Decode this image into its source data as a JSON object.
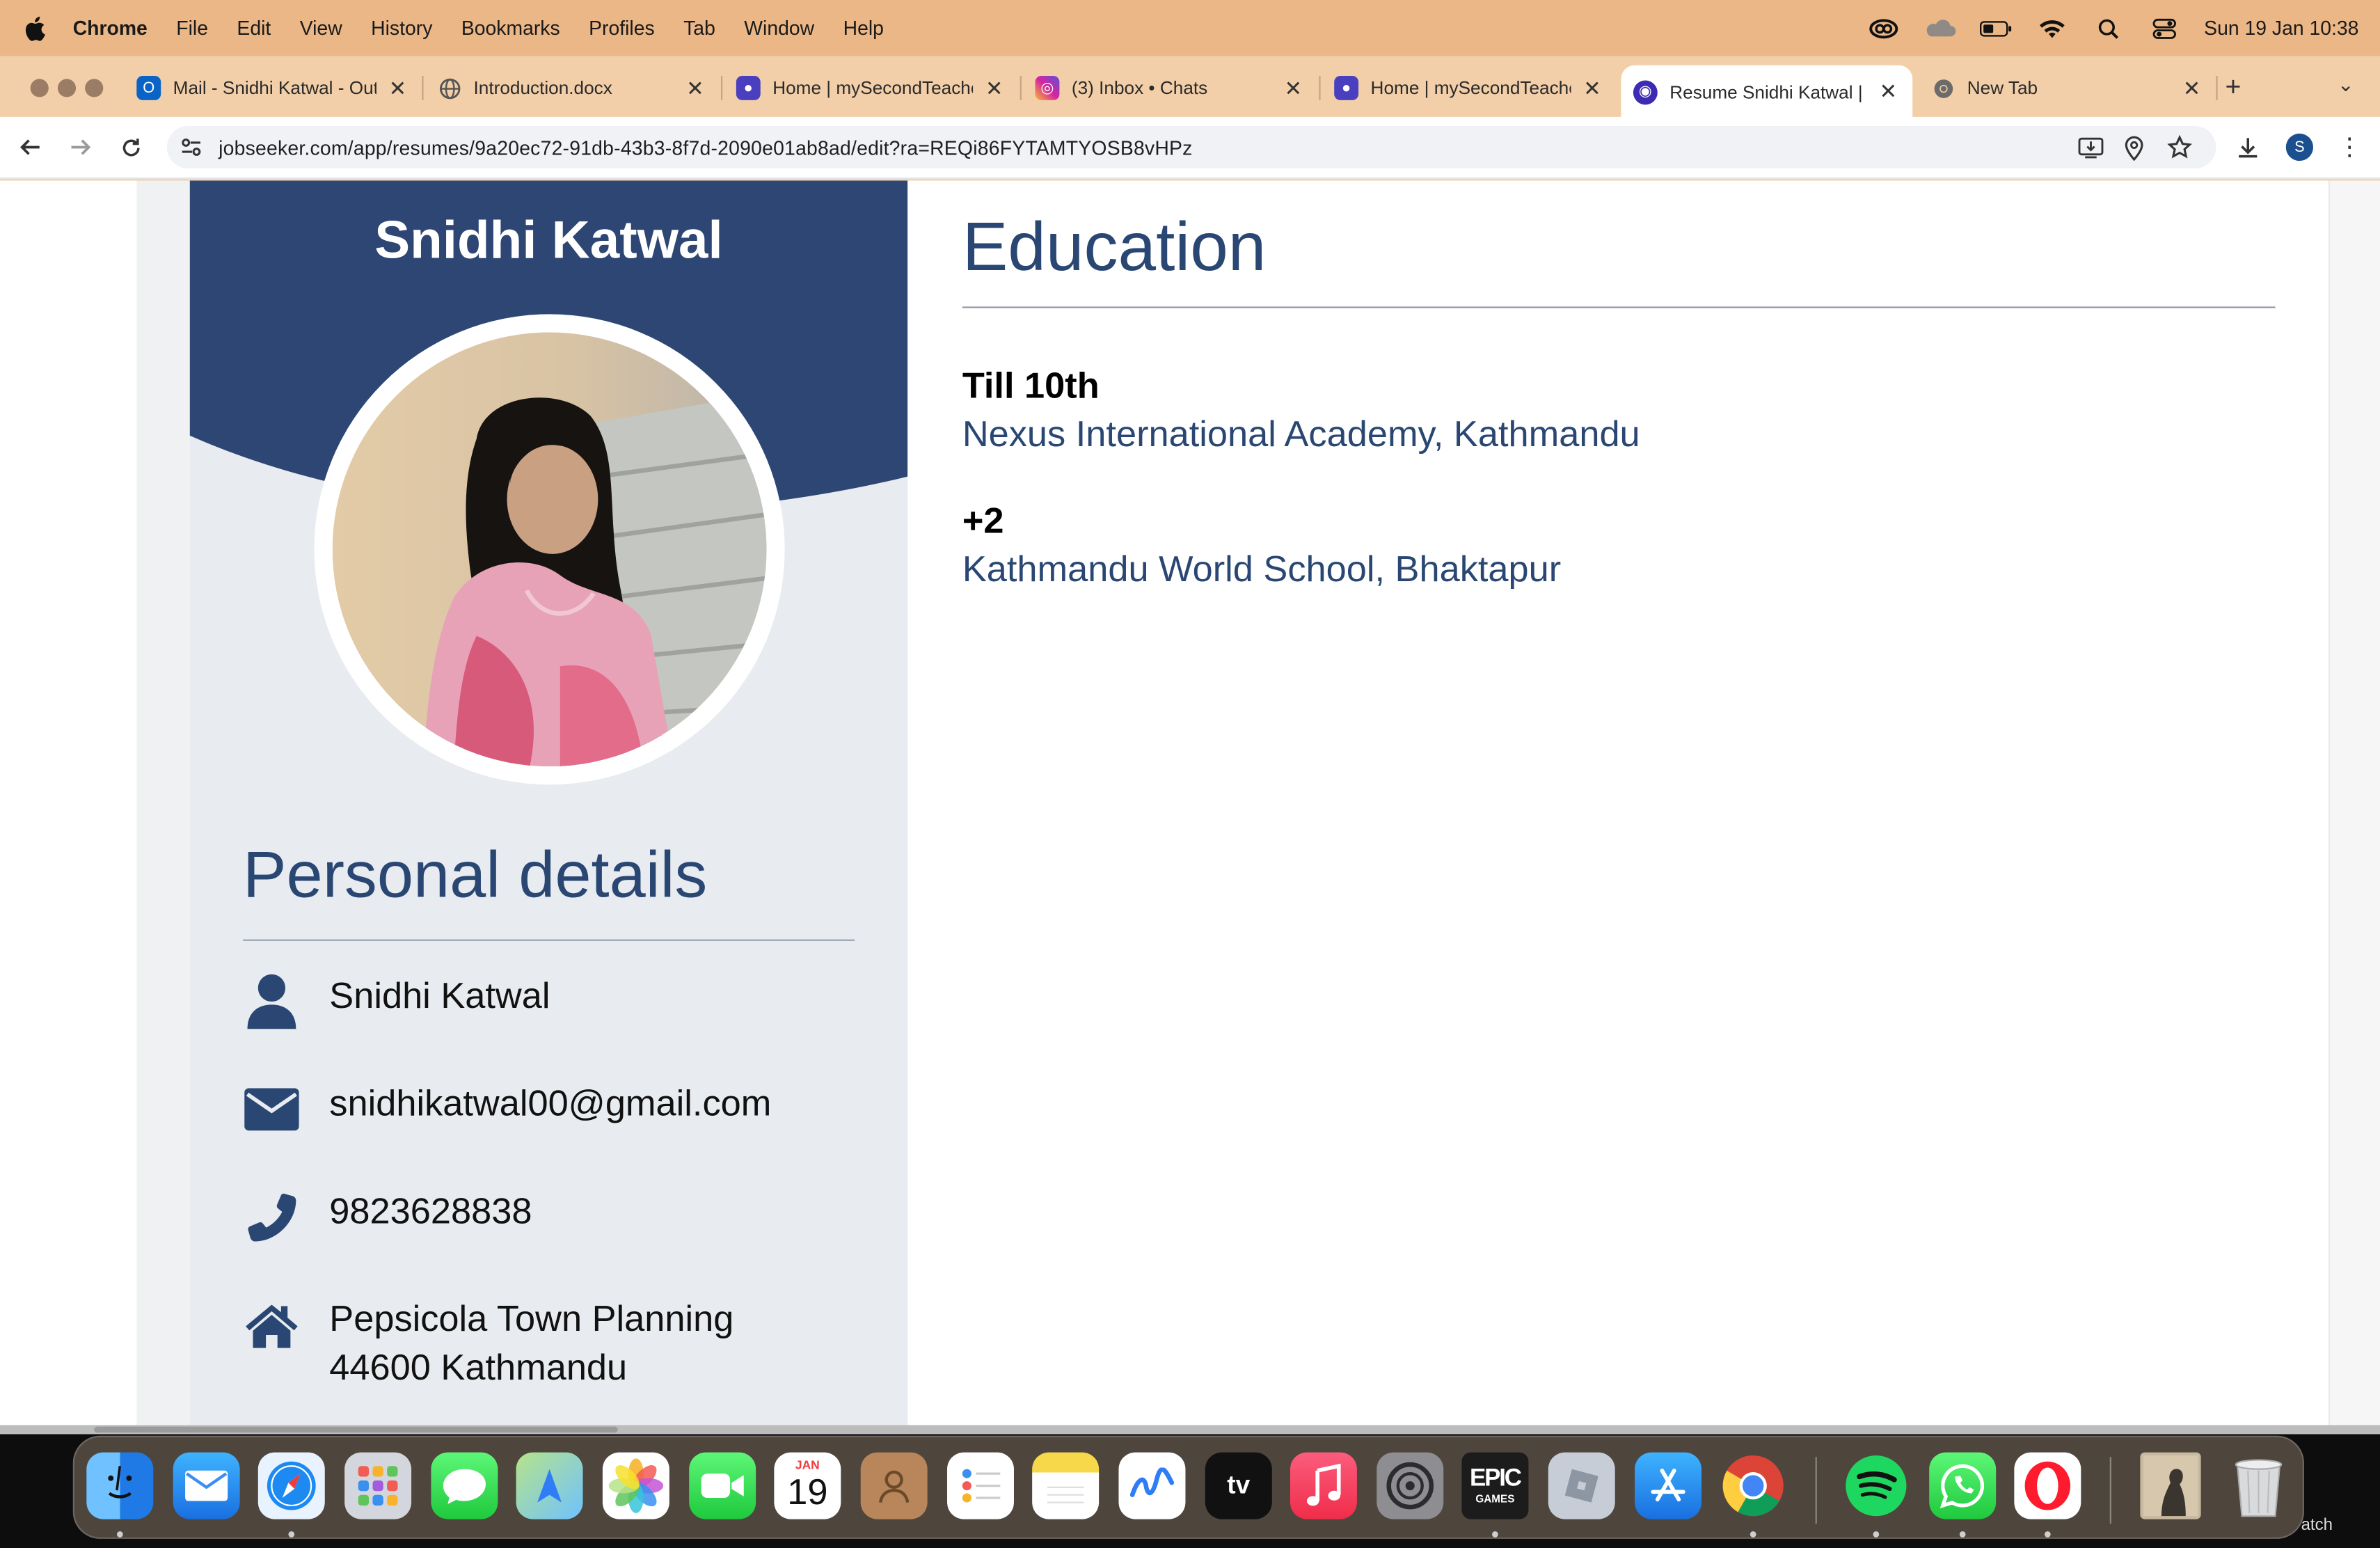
{
  "menubar": {
    "app_name": "Chrome",
    "items": [
      "File",
      "Edit",
      "View",
      "History",
      "Bookmarks",
      "Profiles",
      "Tab",
      "Window",
      "Help"
    ],
    "clock": "Sun 19 Jan  10:38",
    "status_icons": [
      "creative-cloud-icon",
      "cloud-icon",
      "battery-icon",
      "wifi-icon",
      "spotlight-search-icon",
      "control-center-icon"
    ]
  },
  "tabs": [
    {
      "title": "Mail - Snidhi Katwal - Outlook",
      "icon": "outlook-icon",
      "color": "#0a64c8"
    },
    {
      "title": "Introduction.docx",
      "icon": "globe-icon",
      "color": "#5f6368"
    },
    {
      "title": "Home | mySecondTeacher",
      "icon": "mysecondteacher-icon",
      "color": "#4a3fbf"
    },
    {
      "title": "(3) Inbox • Chats",
      "icon": "instagram-icon",
      "color": "#d6249f"
    },
    {
      "title": "Home | mySecondTeacher",
      "icon": "mysecondteacher-icon",
      "color": "#4a3fbf"
    },
    {
      "title": "Resume Snidhi Katwal | Jobseeker",
      "icon": "jobseeker-icon",
      "color": "#3d2bb3",
      "active": true
    },
    {
      "title": "New Tab",
      "icon": "chrome-icon",
      "color": "#5f6368"
    }
  ],
  "toolbar": {
    "url": "jobseeker.com/app/resumes/9a20ec72-91db-43b3-8f7d-2090e01ab8ad/edit?ra=REQi86FYTAMTYOSB8vHPz",
    "profile_initial": "S"
  },
  "resume": {
    "name": "Snidhi Katwal",
    "personal_title": "Personal details",
    "details": [
      {
        "icon": "person-icon",
        "lines": [
          "Snidhi Katwal"
        ]
      },
      {
        "icon": "envelope-icon",
        "lines": [
          "snidhikatwal00@gmail.com"
        ]
      },
      {
        "icon": "phone-icon",
        "lines": [
          "9823628838"
        ]
      },
      {
        "icon": "home-icon",
        "lines": [
          "Pepsicola Town  Planning",
          "44600 Kathmandu"
        ]
      }
    ],
    "education_title": "Education",
    "education": [
      {
        "degree": "Till 10th",
        "school": "Nexus International Academy, Kathmandu"
      },
      {
        "degree": "+2",
        "school": "Kathmandu World School, Bhaktapur"
      }
    ],
    "colors": {
      "accent": "#2a4773",
      "header": "#2d4673",
      "sidebar": "#e8ebef"
    }
  },
  "dock": {
    "apps": [
      "finder",
      "mail",
      "safari",
      "launchpad",
      "messages",
      "maps",
      "photos",
      "facetime",
      "calendar",
      "contacts",
      "reminders",
      "notes",
      "freeform",
      "apple-tv",
      "music",
      "system-settings",
      "epic-games",
      "roblox",
      "app-store",
      "chrome",
      "spotify",
      "whatsapp",
      "opera",
      "preview-image",
      "trash"
    ],
    "calendar_month": "JAN",
    "calendar_day": "19",
    "tv_label": "tv",
    "epic_label": "EPIC",
    "epic_sublabel": "GAMES",
    "watch_label": "atch"
  }
}
